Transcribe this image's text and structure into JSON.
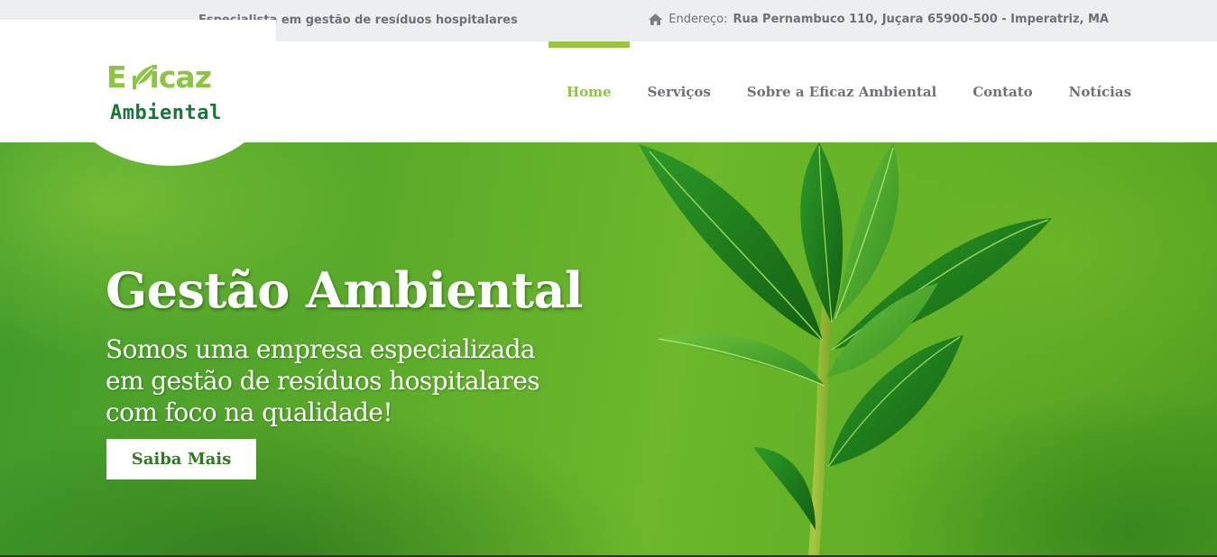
{
  "topbar": {
    "tagline": "Especialista em gestão de resíduos hospitalares",
    "address_prefix": "Endereço:",
    "address_value": "Rua Pernambuco 110, Juçara 65900-500 - Imperatriz, MA",
    "icon": "home-icon"
  },
  "logo": {
    "line1_prefix": "E",
    "line1_suffix": "icaz",
    "line2": "Ambiental",
    "icon": "leaf-icon"
  },
  "nav": {
    "items": [
      {
        "label": "Home",
        "active": true
      },
      {
        "label": "Serviços",
        "active": false
      },
      {
        "label": "Sobre a Eficaz Ambiental",
        "active": false
      },
      {
        "label": "Contato",
        "active": false
      },
      {
        "label": "Notícias",
        "active": false
      }
    ]
  },
  "hero": {
    "title": "Gestão Ambiental",
    "text_lines": [
      "Somos uma empresa especializada",
      "em gestão de resíduos hospitalares",
      "com foco na qualidade!"
    ],
    "button_label": "Saiba Mais"
  },
  "colors": {
    "accent": "#8cc540",
    "brand_dark": "#16783a",
    "nav_text": "#6e7176",
    "topbar_bg": "#eceef0"
  }
}
